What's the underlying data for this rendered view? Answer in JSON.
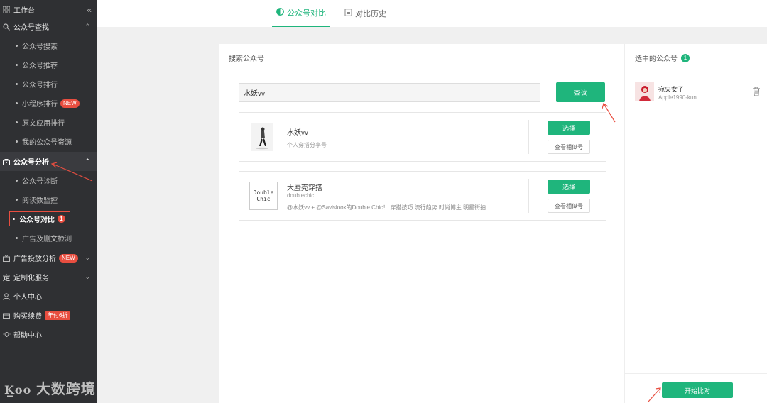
{
  "sidebar": {
    "workbench": "工作台",
    "collapse_icon": "double-chevron-left-icon",
    "sections": [
      {
        "label": "公众号查找",
        "icon": "search-icon"
      },
      {
        "label": "公众号分析",
        "icon": "bag-icon"
      },
      {
        "label": "广告投放分析",
        "icon": "ad-icon",
        "tag": "NEW"
      },
      {
        "label": "定制化服务",
        "icon": "custom-icon"
      },
      {
        "label": "个人中心",
        "icon": "user-icon"
      },
      {
        "label": "购买续费",
        "icon": "card-icon",
        "tag": "年付6折"
      },
      {
        "label": "帮助中心",
        "icon": "bulb-icon"
      }
    ],
    "find_items": [
      "公众号搜索",
      "公众号推荐",
      "公众号排行",
      "小程序排行",
      "原文应用排行",
      "我的公众号资源"
    ],
    "find_items_tag": "NEW",
    "analysis_items": [
      "公众号诊断",
      "阅读数监控",
      "公众号对比",
      "广告及删文检测"
    ],
    "analysis_active_badge": "1",
    "watermark": "大数跨境"
  },
  "tabs": [
    {
      "label": "公众号对比",
      "icon": "half-circle-icon"
    },
    {
      "label": "对比历史",
      "icon": "document-icon"
    }
  ],
  "search": {
    "title": "搜索公众号",
    "value": "水妖vv",
    "query_button": "查询"
  },
  "results": [
    {
      "name": "水妖vv",
      "desc": "个人穿搭分享号",
      "id": "",
      "select": "选择",
      "similar": "查看相似号"
    },
    {
      "name": "大蜃壳穿搭",
      "id": "doublechic",
      "desc": "@水妖vv + @Savislook的Double Chic！ 穿搭技巧 流行趋势 时尚博主 明星街拍 ...",
      "thumb_text": "Double Chic",
      "select": "选择",
      "similar": "查看相似号"
    }
  ],
  "selected": {
    "title": "选中的公众号",
    "count": "1",
    "items": [
      {
        "name": "宛央女子",
        "id": "Apple1990-kun"
      }
    ],
    "start_button": "开始比对"
  },
  "colors": {
    "accent": "#1fb57c",
    "sidebar_bg": "#2f3033",
    "badge_red": "#e84e40"
  }
}
